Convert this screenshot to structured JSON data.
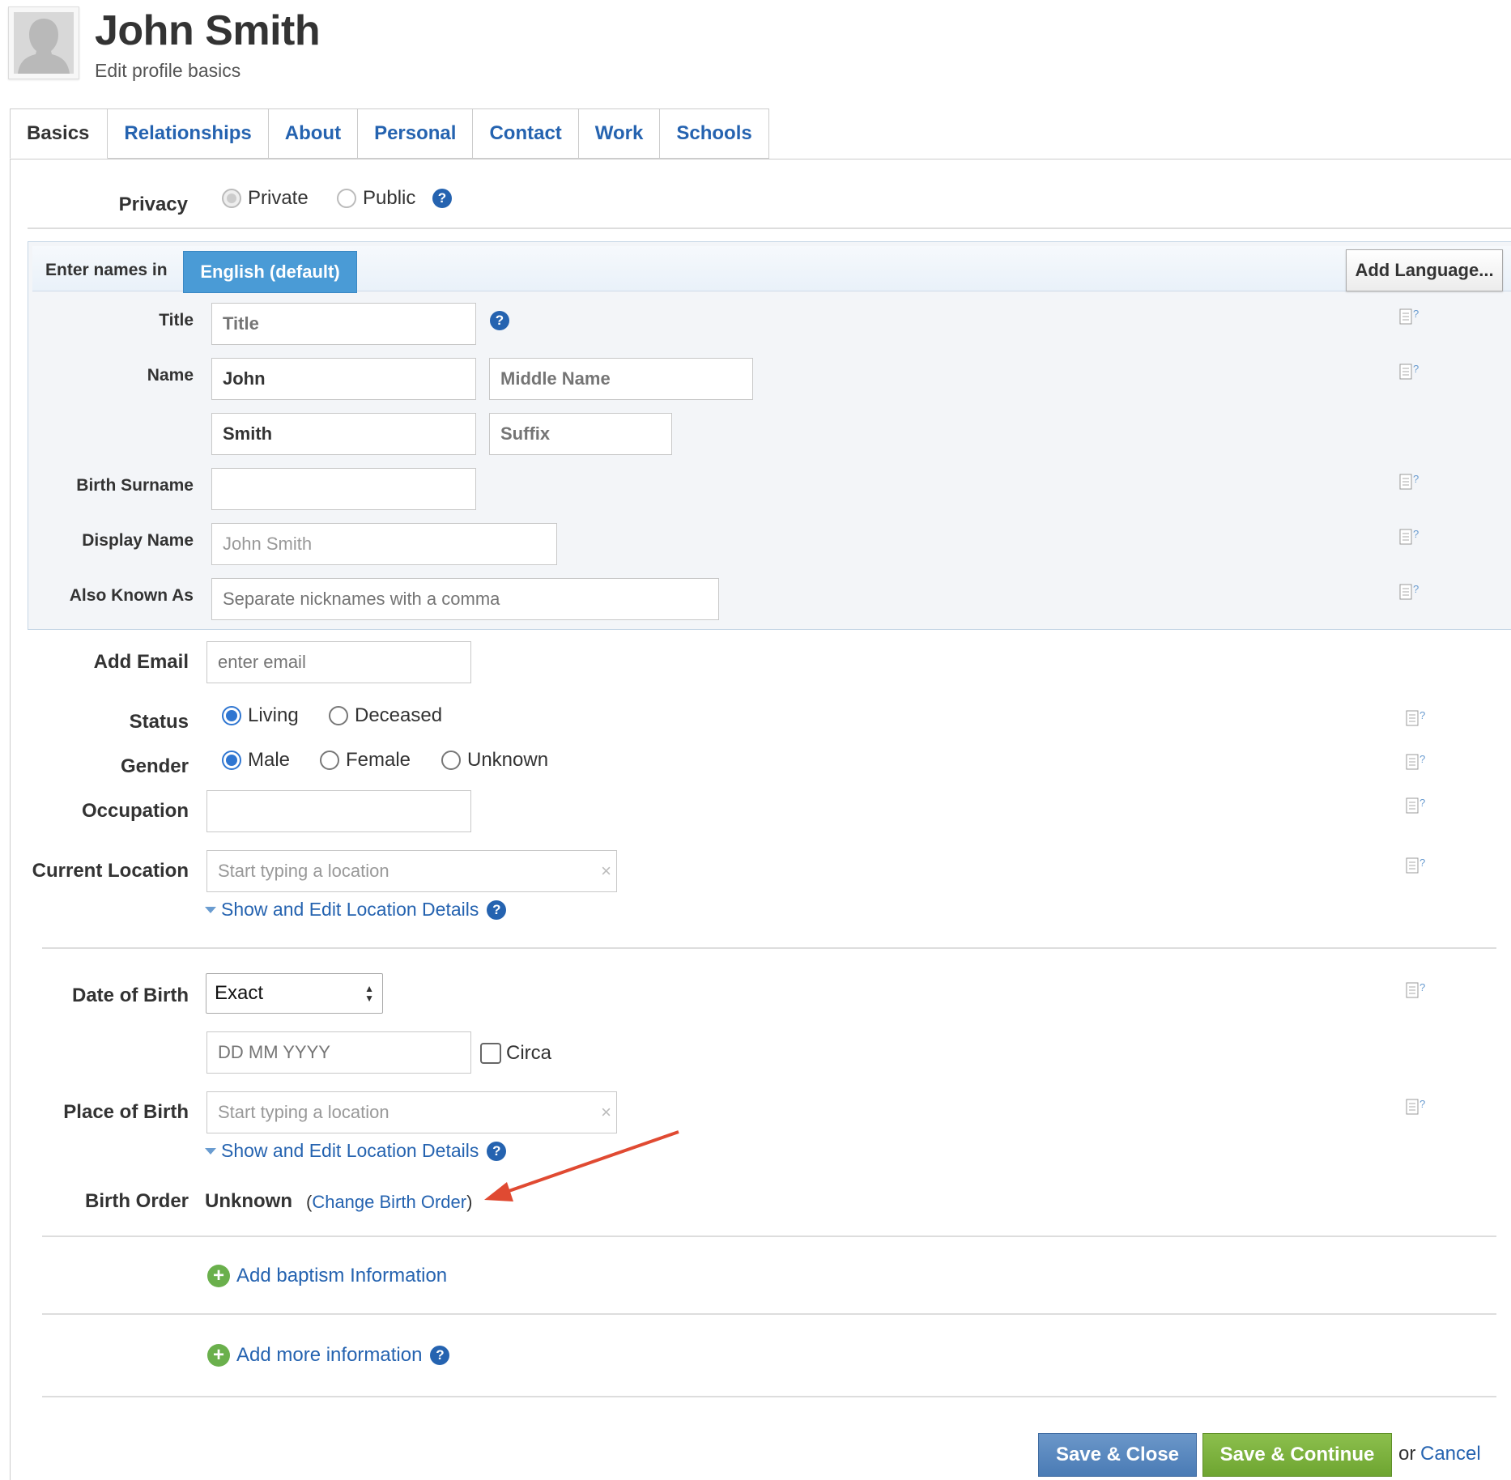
{
  "header": {
    "name": "John Smith",
    "subtitle": "Edit profile basics"
  },
  "tabs": [
    {
      "label": "Basics",
      "active": true
    },
    {
      "label": "Relationships"
    },
    {
      "label": "About"
    },
    {
      "label": "Personal"
    },
    {
      "label": "Contact"
    },
    {
      "label": "Work"
    },
    {
      "label": "Schools"
    }
  ],
  "privacy": {
    "label": "Privacy",
    "options": [
      "Private",
      "Public"
    ],
    "selected": "Private"
  },
  "names": {
    "enter_in": "Enter names in",
    "language_tab": "English (default)",
    "add_language": "Add Language...",
    "title": {
      "label": "Title",
      "placeholder": "Title"
    },
    "name": {
      "label": "Name",
      "first": "John",
      "middle_placeholder": "Middle Name",
      "last": "Smith",
      "suffix_placeholder": "Suffix"
    },
    "birth_surname": {
      "label": "Birth Surname",
      "value": ""
    },
    "display_name": {
      "label": "Display Name",
      "value": "John Smith"
    },
    "aka": {
      "label": "Also Known As",
      "placeholder": "Separate nicknames with a comma"
    }
  },
  "email": {
    "label": "Add Email",
    "placeholder": "enter email"
  },
  "status": {
    "label": "Status",
    "options": [
      "Living",
      "Deceased"
    ],
    "selected": "Living"
  },
  "gender": {
    "label": "Gender",
    "options": [
      "Male",
      "Female",
      "Unknown"
    ],
    "selected": "Male"
  },
  "occupation": {
    "label": "Occupation",
    "value": ""
  },
  "current_location": {
    "label": "Current Location",
    "placeholder": "Start typing a location",
    "details_link": "Show and Edit Location Details"
  },
  "dob": {
    "label": "Date of Birth",
    "mode": "Exact",
    "placeholder": "DD MM YYYY",
    "circa": "Circa"
  },
  "pob": {
    "label": "Place of Birth",
    "placeholder": "Start typing a location",
    "details_link": "Show and Edit Location Details"
  },
  "birth_order": {
    "label": "Birth Order",
    "value": "Unknown",
    "open_paren": "(",
    "link": "Change Birth Order",
    "close_paren": ")"
  },
  "add_baptism": "Add baptism Information",
  "add_more": "Add more information",
  "footer": {
    "save_close": "Save & Close",
    "save_continue": "Save & Continue",
    "or": "or",
    "cancel": "Cancel"
  },
  "icons": {
    "help": "?",
    "clear": "×",
    "plus": "+"
  },
  "colors": {
    "link": "#2563b0",
    "lang_tab": "#4a9bd6",
    "save_close": "#4a7bb5",
    "save_continue": "#6ea531",
    "annotation_arrow": "#e04a32"
  }
}
